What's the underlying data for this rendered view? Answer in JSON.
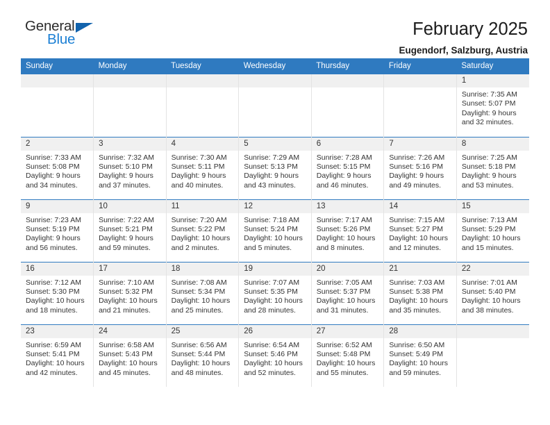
{
  "logo": {
    "primary_text": "General",
    "secondary_text": "Blue",
    "primary_color": "#2b2b2b",
    "secondary_color": "#1b7fd4",
    "triangle_color": "#1263ad"
  },
  "header": {
    "title": "February 2025",
    "subtitle": "Eugendorf, Salzburg, Austria"
  },
  "theme": {
    "header_bg": "#2f7ac0",
    "header_text": "#ffffff",
    "daynum_bg": "#f0f0f0",
    "cell_bg": "#ffffff",
    "text": "#333333",
    "row_divider": "#2f7ac0",
    "cell_divider": "#e3e3e3"
  },
  "weekday_headers": [
    "Sunday",
    "Monday",
    "Tuesday",
    "Wednesday",
    "Thursday",
    "Friday",
    "Saturday"
  ],
  "labels": {
    "sunrise_prefix": "Sunrise:",
    "sunset_prefix": "Sunset:",
    "daylight_prefix": "Daylight:"
  },
  "weeks": [
    [
      {
        "day": "",
        "empty": true
      },
      {
        "day": "",
        "empty": true
      },
      {
        "day": "",
        "empty": true
      },
      {
        "day": "",
        "empty": true
      },
      {
        "day": "",
        "empty": true
      },
      {
        "day": "",
        "empty": true
      },
      {
        "day": "1",
        "sunrise": "Sunrise: 7:35 AM",
        "sunset": "Sunset: 5:07 PM",
        "daylight_line1": "Daylight: 9 hours",
        "daylight_line2": "and 32 minutes."
      }
    ],
    [
      {
        "day": "2",
        "sunrise": "Sunrise: 7:33 AM",
        "sunset": "Sunset: 5:08 PM",
        "daylight_line1": "Daylight: 9 hours",
        "daylight_line2": "and 34 minutes."
      },
      {
        "day": "3",
        "sunrise": "Sunrise: 7:32 AM",
        "sunset": "Sunset: 5:10 PM",
        "daylight_line1": "Daylight: 9 hours",
        "daylight_line2": "and 37 minutes."
      },
      {
        "day": "4",
        "sunrise": "Sunrise: 7:30 AM",
        "sunset": "Sunset: 5:11 PM",
        "daylight_line1": "Daylight: 9 hours",
        "daylight_line2": "and 40 minutes."
      },
      {
        "day": "5",
        "sunrise": "Sunrise: 7:29 AM",
        "sunset": "Sunset: 5:13 PM",
        "daylight_line1": "Daylight: 9 hours",
        "daylight_line2": "and 43 minutes."
      },
      {
        "day": "6",
        "sunrise": "Sunrise: 7:28 AM",
        "sunset": "Sunset: 5:15 PM",
        "daylight_line1": "Daylight: 9 hours",
        "daylight_line2": "and 46 minutes."
      },
      {
        "day": "7",
        "sunrise": "Sunrise: 7:26 AM",
        "sunset": "Sunset: 5:16 PM",
        "daylight_line1": "Daylight: 9 hours",
        "daylight_line2": "and 49 minutes."
      },
      {
        "day": "8",
        "sunrise": "Sunrise: 7:25 AM",
        "sunset": "Sunset: 5:18 PM",
        "daylight_line1": "Daylight: 9 hours",
        "daylight_line2": "and 53 minutes."
      }
    ],
    [
      {
        "day": "9",
        "sunrise": "Sunrise: 7:23 AM",
        "sunset": "Sunset: 5:19 PM",
        "daylight_line1": "Daylight: 9 hours",
        "daylight_line2": "and 56 minutes."
      },
      {
        "day": "10",
        "sunrise": "Sunrise: 7:22 AM",
        "sunset": "Sunset: 5:21 PM",
        "daylight_line1": "Daylight: 9 hours",
        "daylight_line2": "and 59 minutes."
      },
      {
        "day": "11",
        "sunrise": "Sunrise: 7:20 AM",
        "sunset": "Sunset: 5:22 PM",
        "daylight_line1": "Daylight: 10 hours",
        "daylight_line2": "and 2 minutes."
      },
      {
        "day": "12",
        "sunrise": "Sunrise: 7:18 AM",
        "sunset": "Sunset: 5:24 PM",
        "daylight_line1": "Daylight: 10 hours",
        "daylight_line2": "and 5 minutes."
      },
      {
        "day": "13",
        "sunrise": "Sunrise: 7:17 AM",
        "sunset": "Sunset: 5:26 PM",
        "daylight_line1": "Daylight: 10 hours",
        "daylight_line2": "and 8 minutes."
      },
      {
        "day": "14",
        "sunrise": "Sunrise: 7:15 AM",
        "sunset": "Sunset: 5:27 PM",
        "daylight_line1": "Daylight: 10 hours",
        "daylight_line2": "and 12 minutes."
      },
      {
        "day": "15",
        "sunrise": "Sunrise: 7:13 AM",
        "sunset": "Sunset: 5:29 PM",
        "daylight_line1": "Daylight: 10 hours",
        "daylight_line2": "and 15 minutes."
      }
    ],
    [
      {
        "day": "16",
        "sunrise": "Sunrise: 7:12 AM",
        "sunset": "Sunset: 5:30 PM",
        "daylight_line1": "Daylight: 10 hours",
        "daylight_line2": "and 18 minutes."
      },
      {
        "day": "17",
        "sunrise": "Sunrise: 7:10 AM",
        "sunset": "Sunset: 5:32 PM",
        "daylight_line1": "Daylight: 10 hours",
        "daylight_line2": "and 21 minutes."
      },
      {
        "day": "18",
        "sunrise": "Sunrise: 7:08 AM",
        "sunset": "Sunset: 5:34 PM",
        "daylight_line1": "Daylight: 10 hours",
        "daylight_line2": "and 25 minutes."
      },
      {
        "day": "19",
        "sunrise": "Sunrise: 7:07 AM",
        "sunset": "Sunset: 5:35 PM",
        "daylight_line1": "Daylight: 10 hours",
        "daylight_line2": "and 28 minutes."
      },
      {
        "day": "20",
        "sunrise": "Sunrise: 7:05 AM",
        "sunset": "Sunset: 5:37 PM",
        "daylight_line1": "Daylight: 10 hours",
        "daylight_line2": "and 31 minutes."
      },
      {
        "day": "21",
        "sunrise": "Sunrise: 7:03 AM",
        "sunset": "Sunset: 5:38 PM",
        "daylight_line1": "Daylight: 10 hours",
        "daylight_line2": "and 35 minutes."
      },
      {
        "day": "22",
        "sunrise": "Sunrise: 7:01 AM",
        "sunset": "Sunset: 5:40 PM",
        "daylight_line1": "Daylight: 10 hours",
        "daylight_line2": "and 38 minutes."
      }
    ],
    [
      {
        "day": "23",
        "sunrise": "Sunrise: 6:59 AM",
        "sunset": "Sunset: 5:41 PM",
        "daylight_line1": "Daylight: 10 hours",
        "daylight_line2": "and 42 minutes."
      },
      {
        "day": "24",
        "sunrise": "Sunrise: 6:58 AM",
        "sunset": "Sunset: 5:43 PM",
        "daylight_line1": "Daylight: 10 hours",
        "daylight_line2": "and 45 minutes."
      },
      {
        "day": "25",
        "sunrise": "Sunrise: 6:56 AM",
        "sunset": "Sunset: 5:44 PM",
        "daylight_line1": "Daylight: 10 hours",
        "daylight_line2": "and 48 minutes."
      },
      {
        "day": "26",
        "sunrise": "Sunrise: 6:54 AM",
        "sunset": "Sunset: 5:46 PM",
        "daylight_line1": "Daylight: 10 hours",
        "daylight_line2": "and 52 minutes."
      },
      {
        "day": "27",
        "sunrise": "Sunrise: 6:52 AM",
        "sunset": "Sunset: 5:48 PM",
        "daylight_line1": "Daylight: 10 hours",
        "daylight_line2": "and 55 minutes."
      },
      {
        "day": "28",
        "sunrise": "Sunrise: 6:50 AM",
        "sunset": "Sunset: 5:49 PM",
        "daylight_line1": "Daylight: 10 hours",
        "daylight_line2": "and 59 minutes."
      },
      {
        "day": "",
        "empty": true
      }
    ]
  ]
}
